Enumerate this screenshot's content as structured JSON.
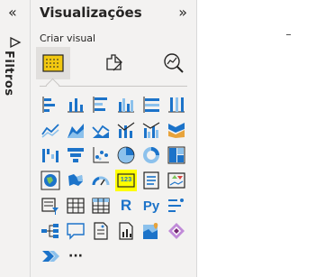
{
  "filters_panel": {
    "title": "Filtros",
    "collapse_glyph": "«"
  },
  "visualizations_pane": {
    "title": "Visualizações",
    "expand_glyph": "»",
    "section_label": "Criar visual",
    "type_buttons": [
      {
        "name": "build-visual",
        "active": true
      },
      {
        "name": "format-visual",
        "active": false
      },
      {
        "name": "analytics",
        "active": false
      }
    ],
    "icon_rows": [
      [
        "stacked-bar",
        "stacked-column",
        "clustered-bar",
        "clustered-column",
        "100-stacked-bar",
        "100-stacked-column"
      ],
      [
        "line",
        "area",
        "stacked-area",
        "line-and-column",
        "line-and-clustered-column",
        "ribbon"
      ],
      [
        "waterfall",
        "funnel",
        "scatter",
        "pie",
        "donut",
        "treemap"
      ],
      [
        "map",
        "filled-map",
        "gauge",
        "card",
        "multi-row-card",
        "kpi"
      ],
      [
        "slicer",
        "table",
        "matrix",
        "r-visual",
        "python-visual",
        "key-influencers"
      ],
      [
        "decomposition-tree",
        "qa",
        "smart-narrative",
        "paginated-report",
        "azure-map",
        "power-apps"
      ],
      [
        "power-automate",
        "more"
      ]
    ],
    "selected_icon": "card",
    "text_glyphs": {
      "r": "R",
      "py": "Py",
      "card": "123",
      "more": "···"
    }
  },
  "colors": {
    "accent_blue": "#1c73c9",
    "light_blue": "#8cc1ec",
    "highlight": "#ffff00",
    "pane_bg": "#f3f2f1",
    "table_yellow": "#f2c811"
  }
}
